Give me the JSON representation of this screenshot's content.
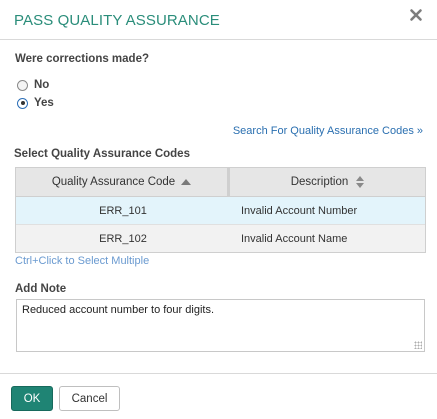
{
  "dialog": {
    "title": "PASS QUALITY ASSURANCE",
    "close_icon": "close-x-icon"
  },
  "corrections": {
    "question": "Were corrections made?",
    "options": [
      {
        "label": "No",
        "selected": false
      },
      {
        "label": "Yes",
        "selected": true
      }
    ]
  },
  "search_link": "Search For Quality Assurance Codes »",
  "codes_section": {
    "label": "Select Quality Assurance Codes",
    "columns": [
      {
        "header": "Quality Assurance Code",
        "sort": "ascending"
      },
      {
        "header": "Description",
        "sort": "sortable"
      }
    ],
    "rows": [
      {
        "code": "ERR_101",
        "description": "Invalid Account Number",
        "selected": true
      },
      {
        "code": "ERR_102",
        "description": "Invalid Account Name",
        "selected": false
      }
    ],
    "hint": "Ctrl+Click to Select Multiple"
  },
  "note": {
    "label": "Add Note",
    "value": "Reduced account number to four digits."
  },
  "buttons": {
    "ok": "OK",
    "cancel": "Cancel"
  },
  "colors": {
    "title": "#2a8d7a",
    "ok_button": "#1f8474",
    "link": "#2a6fb0",
    "selected_row": "#e3f4fb"
  }
}
